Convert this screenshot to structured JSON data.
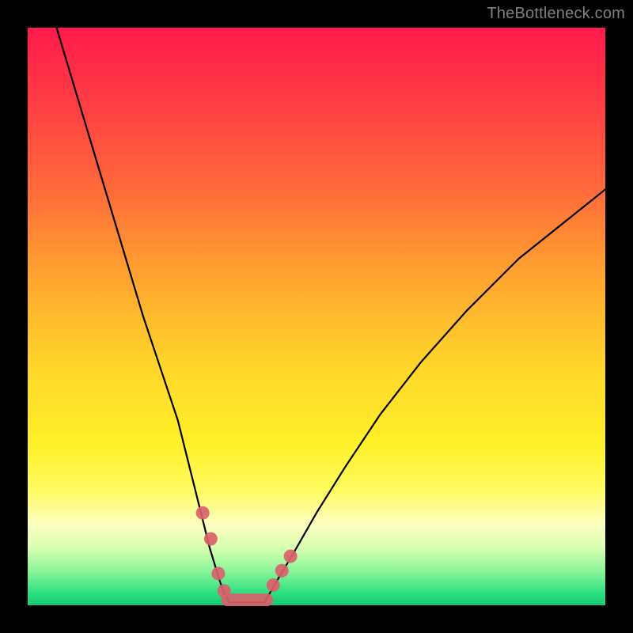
{
  "watermark": "TheBottleneck.com",
  "chart_data": {
    "type": "line",
    "title": "",
    "xlabel": "",
    "ylabel": "",
    "xlim": [
      0,
      100
    ],
    "ylim": [
      0,
      100
    ],
    "grid": false,
    "legend": false,
    "series": [
      {
        "name": "left-branch",
        "x": [
          5,
          8,
          11,
          14,
          17,
          20,
          23,
          26,
          28,
          30,
          31.5,
          33,
          34,
          35
        ],
        "y": [
          100,
          90,
          80,
          70,
          60,
          50,
          41,
          32,
          24,
          16,
          10,
          5,
          2,
          0.5
        ]
      },
      {
        "name": "right-branch",
        "x": [
          41,
          43,
          46,
          50,
          55,
          61,
          68,
          76,
          85,
          95,
          100
        ],
        "y": [
          0.5,
          4,
          9,
          16,
          24,
          33,
          42,
          51,
          60,
          68,
          72
        ]
      }
    ],
    "flat_bottom": {
      "x_start": 35,
      "x_end": 41,
      "y": 0.5
    },
    "markers_left": [
      {
        "x": 30.3,
        "y": 16
      },
      {
        "x": 31.7,
        "y": 11.5
      },
      {
        "x": 33.0,
        "y": 5.5
      },
      {
        "x": 34.0,
        "y": 2.5
      }
    ],
    "markers_right": [
      {
        "x": 42.5,
        "y": 3.5
      },
      {
        "x": 44.0,
        "y": 6.0
      },
      {
        "x": 45.5,
        "y": 8.5
      }
    ],
    "bottom_blob": {
      "x_start": 33.5,
      "x_end": 42.5,
      "y": 0.8
    },
    "colors": {
      "curve": "#000000",
      "marker": "#d9616b",
      "gradient_top": "#ff1a4a",
      "gradient_bottom": "#18c770"
    }
  }
}
